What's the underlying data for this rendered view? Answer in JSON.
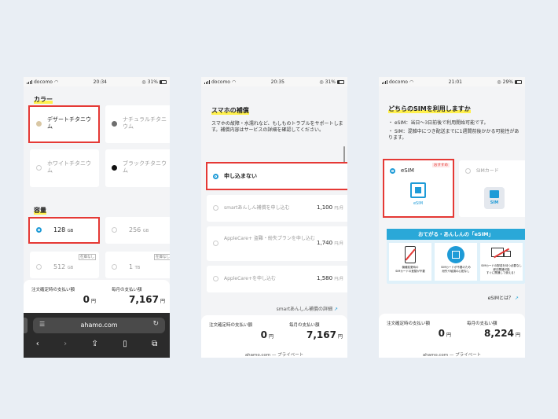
{
  "phone1": {
    "status": {
      "carrier": "docomo",
      "time": "20:34",
      "battery": "31%"
    },
    "section_color": "カラー",
    "colors": [
      {
        "label": "デザートチタニウム",
        "swatch": "#d9c7a4",
        "selected": true
      },
      {
        "label": "ナチュラルチタニウム",
        "swatch": "#6e6e6e",
        "selected": false
      },
      {
        "label": "ホワイトチタニウム",
        "swatch": "#f4f4f4",
        "selected": false
      },
      {
        "label": "ブラックチタニウム",
        "swatch": "#111111",
        "selected": false
      }
    ],
    "section_capacity": "容量",
    "capacities": [
      {
        "value": "128",
        "unit": "GB",
        "badge": ""
      },
      {
        "value": "256",
        "unit": "GB",
        "badge": ""
      },
      {
        "value": "512",
        "unit": "GB",
        "badge": "在庫なし"
      },
      {
        "value": "1",
        "unit": "TB",
        "badge": "在庫なし"
      }
    ],
    "price": {
      "order_label": "注文確定時の支払い額",
      "order_value": "0",
      "monthly_label": "毎月の支払い額",
      "monthly_value": "7,167",
      "yen": "円"
    },
    "browser": {
      "url": "ahamo.com"
    }
  },
  "phone2": {
    "status": {
      "carrier": "docomo",
      "time": "20:35",
      "battery": "31%"
    },
    "heading": "スマホの補償",
    "description": "スマホの故障・水濡れなど、もしものトラブルをサポートします。補償内容はサービスの詳細を確認してください。",
    "options": [
      {
        "label": "申し込まない",
        "price": "",
        "selected": true
      },
      {
        "label": "smartあんしん補償を申し込む",
        "price": "1,100",
        "selected": false
      },
      {
        "label": "AppleCare+ 盗難・紛失プランを申し込む",
        "price": "1,740",
        "selected": false
      },
      {
        "label": "AppleCare+を申し込む",
        "price": "1,580",
        "selected": false
      }
    ],
    "per_month": "円/月",
    "details_link": "smartあんしん補償の詳細",
    "price": {
      "order_label": "注文確定時の支払い額",
      "order_value": "0",
      "monthly_label": "毎月の支払い額",
      "monthly_value": "7,167",
      "yen": "円"
    },
    "footer": "ahamo.com — プライベート"
  },
  "phone3": {
    "status": {
      "carrier": "docomo",
      "time": "21:01",
      "battery": "29%"
    },
    "heading": "どちらのSIMを利用しますか",
    "bullets": [
      "・ eSIM：当日〜3日前後で利用開始可能です。",
      "・ SIM：混雑中につき配送までに1週間前後かかる可能性があります。"
    ],
    "esim": {
      "label": "eSIM",
      "badge": "おすすめ",
      "icon_text": "eSIM"
    },
    "sim": {
      "label": "SIMカード",
      "icon_text": "SIM"
    },
    "banner": {
      "title": "おてがる・あんしんの「eSIM」",
      "captions": [
        "機種変更時の\nSIMカードの差替が不要",
        "SIMカードが不要のため\n紛失や破損の心配なし",
        "SIMカードの配送を待つ必要なし\n即日開通可能\nすぐに開通して使える！"
      ]
    },
    "what_is_esim": "eSIMとは？",
    "price": {
      "order_label": "注文確定時の支払い額",
      "order_value": "0",
      "monthly_label": "毎月の支払い額",
      "monthly_value": "8,224",
      "yen": "円"
    },
    "footer": "ahamo.com — プライベート"
  },
  "colors": {
    "accent": "#1e9bd7",
    "highlight": "#fff04d",
    "red": "#e53935",
    "banner": "#2aa8d8"
  }
}
